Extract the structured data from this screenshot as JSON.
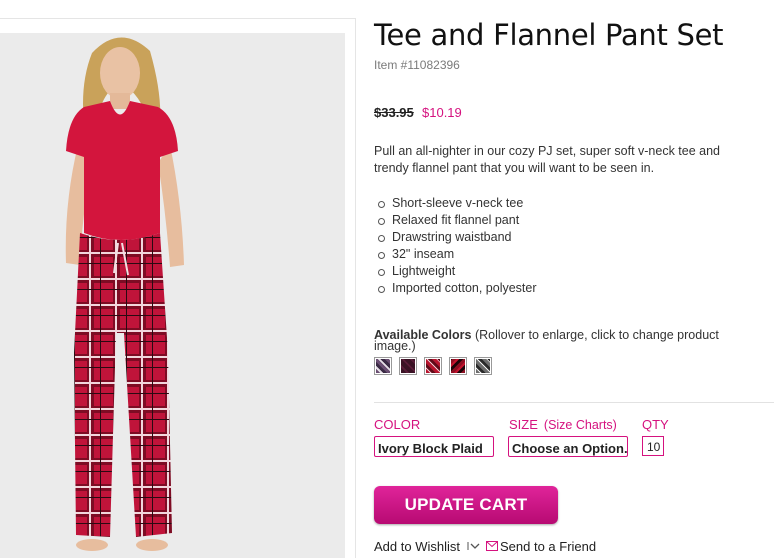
{
  "product": {
    "title": "Tee and Flannel Pant Set",
    "item_number": "Item #11082396",
    "price_original": "$33.95",
    "price_sale": "$10.19",
    "description": "Pull an all-nighter in our cozy PJ set, super soft v-neck tee and trendy flannel pant that you will want to be seen in.",
    "features": [
      "Short-sleeve v-neck tee",
      "Relaxed fit flannel pant",
      "Drawstring waistband",
      "32\" inseam",
      "Lightweight",
      "Imported cotton, polyester"
    ]
  },
  "colors": {
    "label": "Available Colors",
    "hint": "(Rollover to enlarge, click to change product image.)",
    "swatches": [
      {
        "name": "ivory-block-plaid",
        "color": "#6a4e72"
      },
      {
        "name": "dark-plum",
        "color": "#3a1224"
      },
      {
        "name": "red-plaid",
        "color": "#b8142e"
      },
      {
        "name": "red-black-plaid",
        "color": "#8e0e22"
      },
      {
        "name": "grey-plaid",
        "color": "#6d6d6d"
      }
    ]
  },
  "options": {
    "color_label": "COLOR",
    "color_value": "Ivory Block Plaid",
    "size_label": "SIZE",
    "size_charts_link": "(Size Charts)",
    "size_value": "Choose an Option...",
    "qty_label": "QTY",
    "qty_value": "10"
  },
  "actions": {
    "update_cart": "UPDATE CART",
    "wishlist": "Add to Wishlist",
    "send_friend": "Send to a Friend"
  },
  "theme": {
    "accent": "#d5127f"
  }
}
